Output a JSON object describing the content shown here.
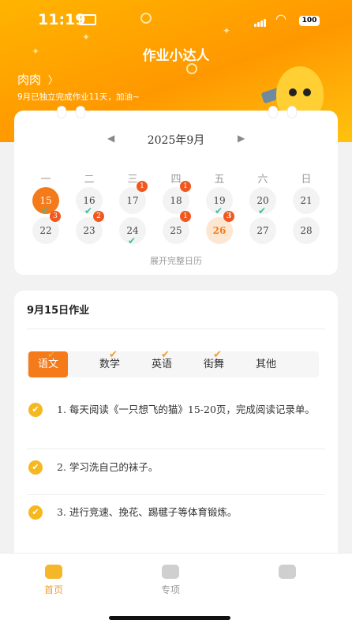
{
  "status_bar": {
    "time": "11:19",
    "battery": "100"
  },
  "header": {
    "title": "作业小达人",
    "child_name": "肉肉",
    "tagline": "9月已独立完成作业11天，加油~"
  },
  "calendar": {
    "month": "2025年9月",
    "weekdays": [
      "一",
      "二",
      "三",
      "四",
      "五",
      "六",
      "日"
    ],
    "days": [
      {
        "d": "15",
        "badge": "",
        "check": true,
        "state": "selected"
      },
      {
        "d": "16",
        "badge": "",
        "check": true,
        "state": ""
      },
      {
        "d": "17",
        "badge": "1",
        "check": false,
        "state": ""
      },
      {
        "d": "18",
        "badge": "1",
        "check": false,
        "state": ""
      },
      {
        "d": "19",
        "badge": "",
        "check": true,
        "state": ""
      },
      {
        "d": "20",
        "badge": "",
        "check": true,
        "state": ""
      },
      {
        "d": "21",
        "badge": "",
        "check": false,
        "state": ""
      },
      {
        "d": "22",
        "badge": "3",
        "check": false,
        "state": ""
      },
      {
        "d": "23",
        "badge": "2",
        "check": false,
        "state": ""
      },
      {
        "d": "24",
        "badge": "",
        "check": true,
        "state": ""
      },
      {
        "d": "25",
        "badge": "1",
        "check": false,
        "state": ""
      },
      {
        "d": "26",
        "badge": "3",
        "check": false,
        "state": "today"
      },
      {
        "d": "27",
        "badge": "",
        "check": false,
        "state": ""
      },
      {
        "d": "28",
        "badge": "",
        "check": false,
        "state": ""
      }
    ],
    "expand_label": "展开完整日历"
  },
  "homework": {
    "title": "9月15日作业",
    "tabs": [
      {
        "label": "语文",
        "active": true,
        "done": true
      },
      {
        "label": "数学",
        "active": false,
        "done": true
      },
      {
        "label": "英语",
        "active": false,
        "done": true
      },
      {
        "label": "街舞",
        "active": false,
        "done": true
      },
      {
        "label": "其他",
        "active": false,
        "done": false
      }
    ],
    "tasks": [
      "1. 每天阅读《一只想飞的猫》15-20页，完成阅读记录单。",
      "2. 学习洗自己的袜子。",
      "3. 进行竞速、挽花、踢毽子等体育锻炼。"
    ]
  },
  "nav": [
    {
      "label": "首页",
      "active": true
    },
    {
      "label": "专项",
      "active": false
    },
    {
      "label": "",
      "active": false
    }
  ],
  "colors": {
    "accent": "#f47a1a",
    "header": "#ffb400",
    "check": "#3bbfa0",
    "badge": "#f0581f"
  }
}
